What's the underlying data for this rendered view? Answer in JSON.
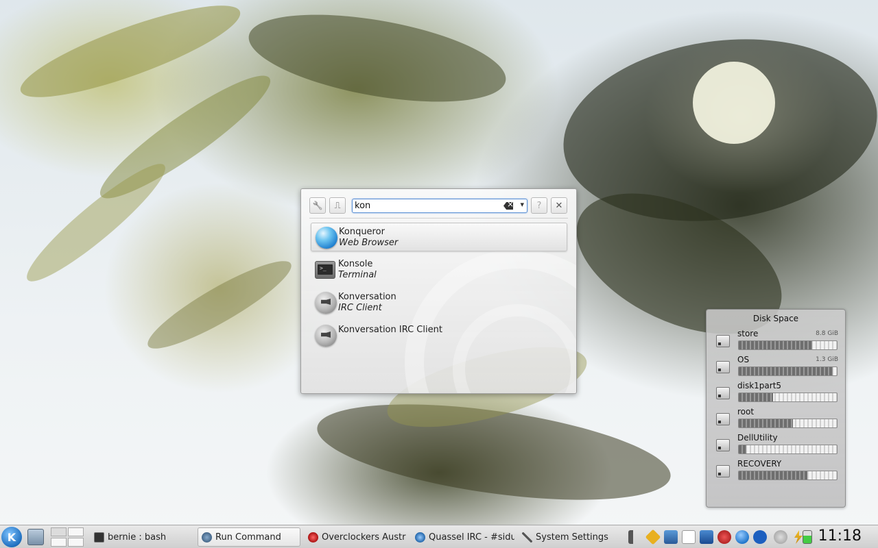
{
  "krunner": {
    "search_value": "kon",
    "results": [
      {
        "name": "Konqueror",
        "description": "Web Browser",
        "icon": "globe-icon"
      },
      {
        "name": "Konsole",
        "description": "Terminal",
        "icon": "terminal-icon"
      },
      {
        "name": "Konversation",
        "description": "IRC Client",
        "icon": "chat-bubble-icon"
      },
      {
        "name": "Konversation IRC Client",
        "description": "",
        "icon": "chat-bubble-icon"
      }
    ],
    "help_glyph": "?",
    "close_glyph": "✕",
    "settings_glyph": "🔧",
    "activity_glyph": "⎍",
    "dropdown_glyph": "▾"
  },
  "disk_widget": {
    "title": "Disk Space",
    "disks": [
      {
        "name": "store",
        "size": "8.8 GiB",
        "used_fraction": 0.75
      },
      {
        "name": "OS",
        "size": "1.3 GiB",
        "used_fraction": 0.96
      },
      {
        "name": "disk1part5",
        "size": "",
        "used_fraction": 0.35
      },
      {
        "name": "root",
        "size": "",
        "used_fraction": 0.55
      },
      {
        "name": "DellUtility",
        "size": "",
        "used_fraction": 0.08
      },
      {
        "name": "RECOVERY",
        "size": "",
        "used_fraction": 0.7
      }
    ]
  },
  "taskbar": {
    "k_menu_label": "K",
    "tasks": [
      {
        "label": "bernie : bash",
        "icon": "terminal-icon",
        "active": false
      },
      {
        "label": "Run Command",
        "icon": "run-icon",
        "active": true
      },
      {
        "label": "Overclockers Austr",
        "icon": "browser-icon",
        "active": false
      },
      {
        "label": "Quassel IRC - #sidu",
        "icon": "quassel-icon",
        "active": false
      },
      {
        "label": "System Settings",
        "icon": "settings-icon",
        "active": false
      }
    ],
    "clock": "11:18"
  },
  "colors": {
    "accent": "#5a8fd4",
    "taskbar_bg": "#dcdcdc"
  }
}
